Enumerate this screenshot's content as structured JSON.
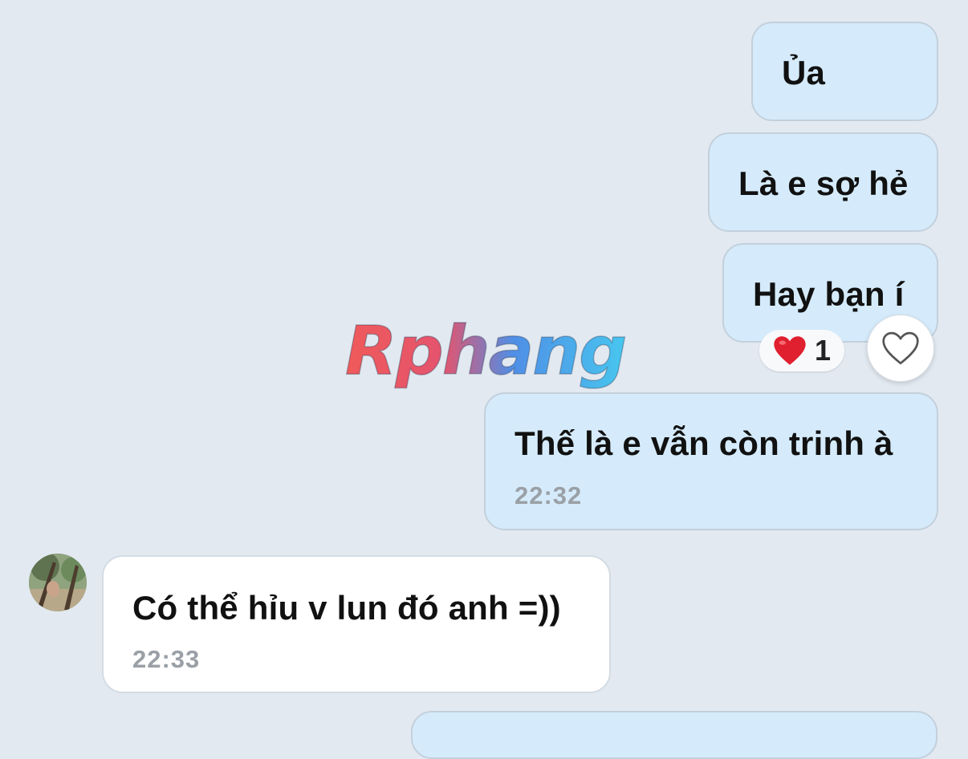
{
  "messages": [
    {
      "text": "Ủa"
    },
    {
      "text": "Là e sợ hẻ"
    },
    {
      "text": "Hay bạn í"
    },
    {
      "text": "Thế là e vẫn còn trinh à",
      "time": "22:32"
    },
    {
      "text": "Có thể hỉu v lun đó anh =))",
      "time": "22:33"
    }
  ],
  "reaction": {
    "emoji": "heart",
    "count": "1"
  },
  "watermark": {
    "text": "Rphang"
  },
  "icons": {
    "like": "heart-outline-icon",
    "reaction": "red-heart-icon",
    "avatar": "contact-avatar"
  },
  "colors": {
    "background": "#e2e9f1",
    "outgoing_bubble": "#d5ebfb",
    "incoming_bubble": "#ffffff",
    "time_text": "#9aa0a6",
    "heart": "#e0202e"
  }
}
